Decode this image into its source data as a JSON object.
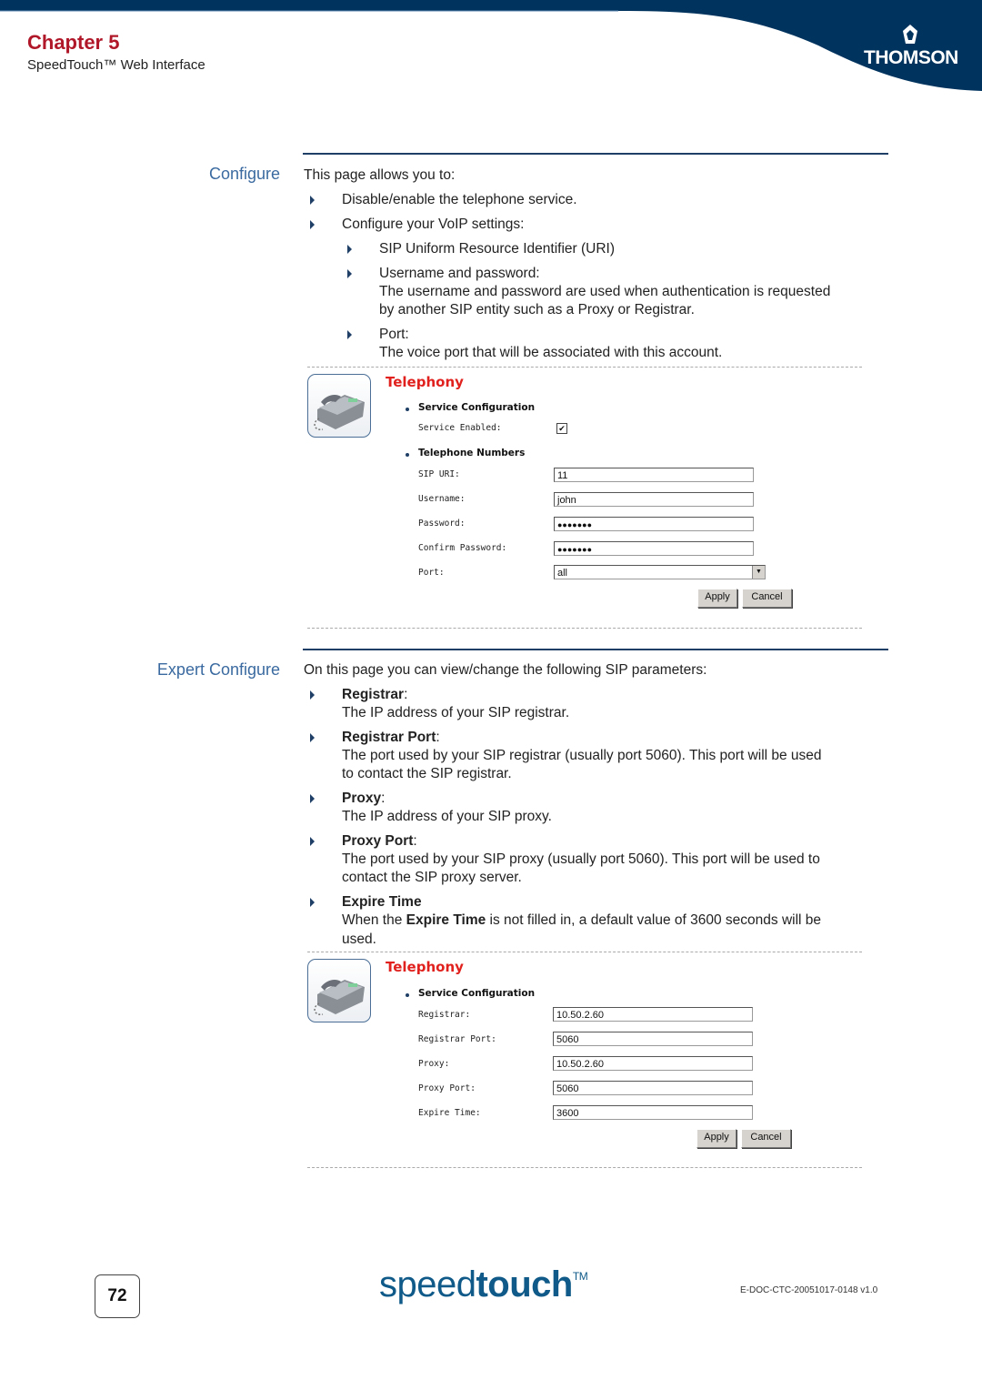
{
  "header": {
    "chapter": "Chapter 5",
    "subtitle": "SpeedTouch™ Web Interface",
    "brand_logo": "THOMSON",
    "brand_color": "#00345f",
    "chapter_color": "#b0182a"
  },
  "configure": {
    "label": "Configure",
    "intro": "This page allows you to:",
    "items": [
      {
        "text": "Disable/enable the telephone service."
      },
      {
        "text": "Configure your VoIP settings:"
      }
    ],
    "subitems": [
      {
        "title": "SIP Uniform Resource Identifier (URI)"
      },
      {
        "title": "Username and password:",
        "desc1": "The username and password are used when authentication is requested",
        "desc2": "by another SIP entity such as a Proxy or Registrar."
      },
      {
        "title": "Port:",
        "desc1": "The voice port that will be associated with this account."
      }
    ],
    "panel": {
      "icon": "telephone-icon",
      "title": "Telephony",
      "section1": "Service Configuration",
      "service_enabled_label": "Service Enabled:",
      "service_enabled_checked": "✔",
      "section2": "Telephone Numbers",
      "fields": [
        {
          "label": "SIP URI:",
          "value": "11"
        },
        {
          "label": "Username:",
          "value": "john"
        },
        {
          "label": "Password:",
          "value": "●●●●●●●"
        },
        {
          "label": "Confirm Password:",
          "value": "●●●●●●●"
        }
      ],
      "port_label": "Port:",
      "port_value": "all",
      "apply": "Apply",
      "cancel": "Cancel"
    }
  },
  "expert": {
    "label": "Expert Configure",
    "intro": "On this page you can view/change the following SIP parameters:",
    "items": [
      {
        "title": "Registrar",
        "suffix": ":",
        "desc1": "The IP address of your SIP registrar."
      },
      {
        "title": "Registrar Port",
        "suffix": ":",
        "desc1": "The port used by your SIP registrar (usually port 5060). This port will be used",
        "desc2": "to contact the SIP registrar."
      },
      {
        "title": "Proxy",
        "suffix": ":",
        "desc1": "The IP address of your SIP proxy."
      },
      {
        "title": "Proxy Port",
        "suffix": ":",
        "desc1": "The port used by your SIP proxy (usually port 5060). This port will be used to",
        "desc2": "contact the SIP proxy server."
      },
      {
        "title": "Expire Time",
        "suffix": "",
        "desc_pre": "When the ",
        "desc_bold": "Expire Time",
        "desc_post": " is not filled in, a default value of 3600 seconds will be",
        "desc2": "used."
      }
    ],
    "panel": {
      "icon": "telephone-icon",
      "title": "Telephony",
      "section1": "Service Configuration",
      "fields": [
        {
          "label": "Registrar:",
          "value": "10.50.2.60"
        },
        {
          "label": "Registrar Port:",
          "value": "5060"
        },
        {
          "label": "Proxy:",
          "value": "10.50.2.60"
        },
        {
          "label": "Proxy Port:",
          "value": "5060"
        },
        {
          "label": "Expire Time:",
          "value": "3600"
        }
      ],
      "apply": "Apply",
      "cancel": "Cancel"
    }
  },
  "footer": {
    "page_number": "72",
    "brand_light": "speed",
    "brand_bold": "touch",
    "brand_tm": "TM",
    "doc_id": "E-DOC-CTC-20051017-0148 v1.0"
  }
}
